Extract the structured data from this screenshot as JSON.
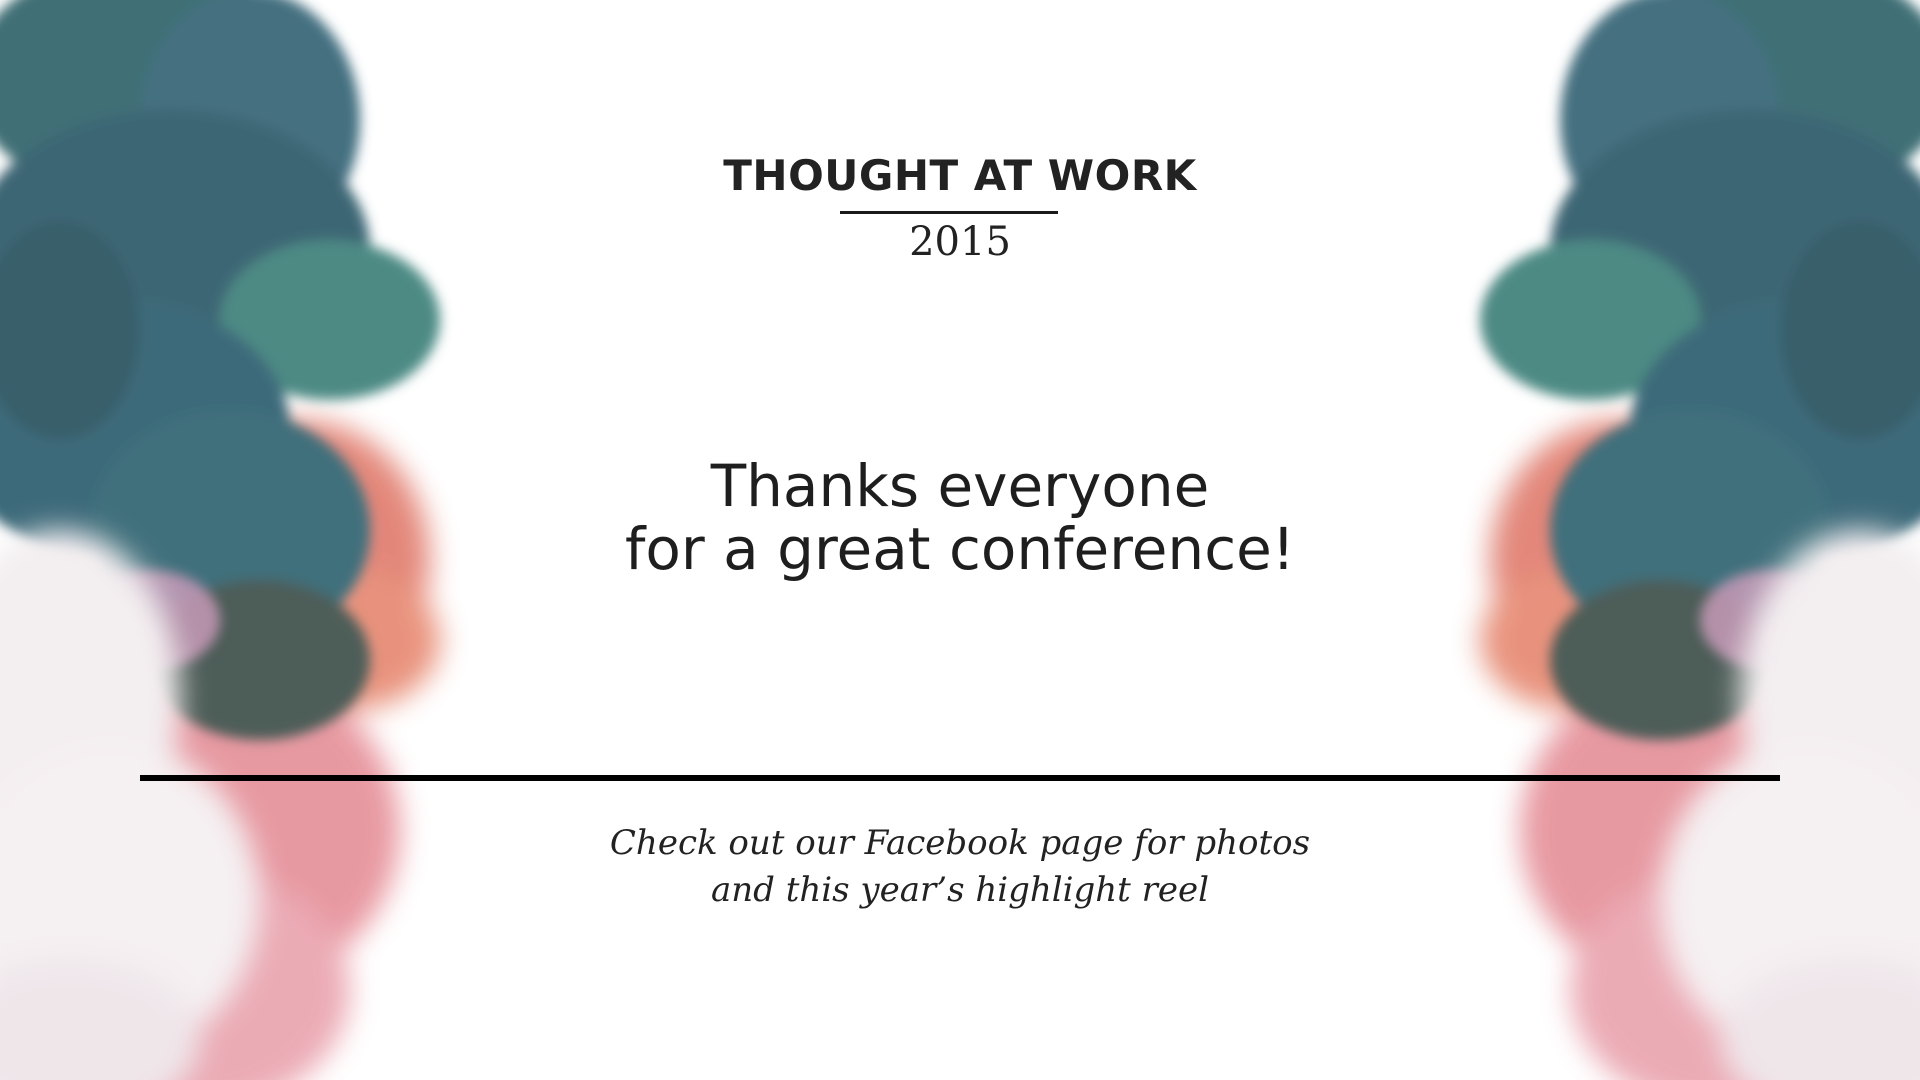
{
  "slide": {
    "brand_title": "THOUGHT AT WORK",
    "brand_year": "2015",
    "headline_line1": "Thanks everyone",
    "headline_line2": "for a great conference!",
    "note_line1": "Check out our Facebook page for photos",
    "note_line2": "and this year’s highlight reel"
  },
  "colors": {
    "background": "#ffffff",
    "text": "#222222",
    "ink_teal": "#3f6f76",
    "ink_coral": "#e07a6c",
    "ink_pink": "#e9a9b4",
    "ink_white": "#f3eef0"
  },
  "decorations": {
    "left": "ink-smoke-illustration",
    "right": "ink-smoke-illustration-mirrored"
  }
}
